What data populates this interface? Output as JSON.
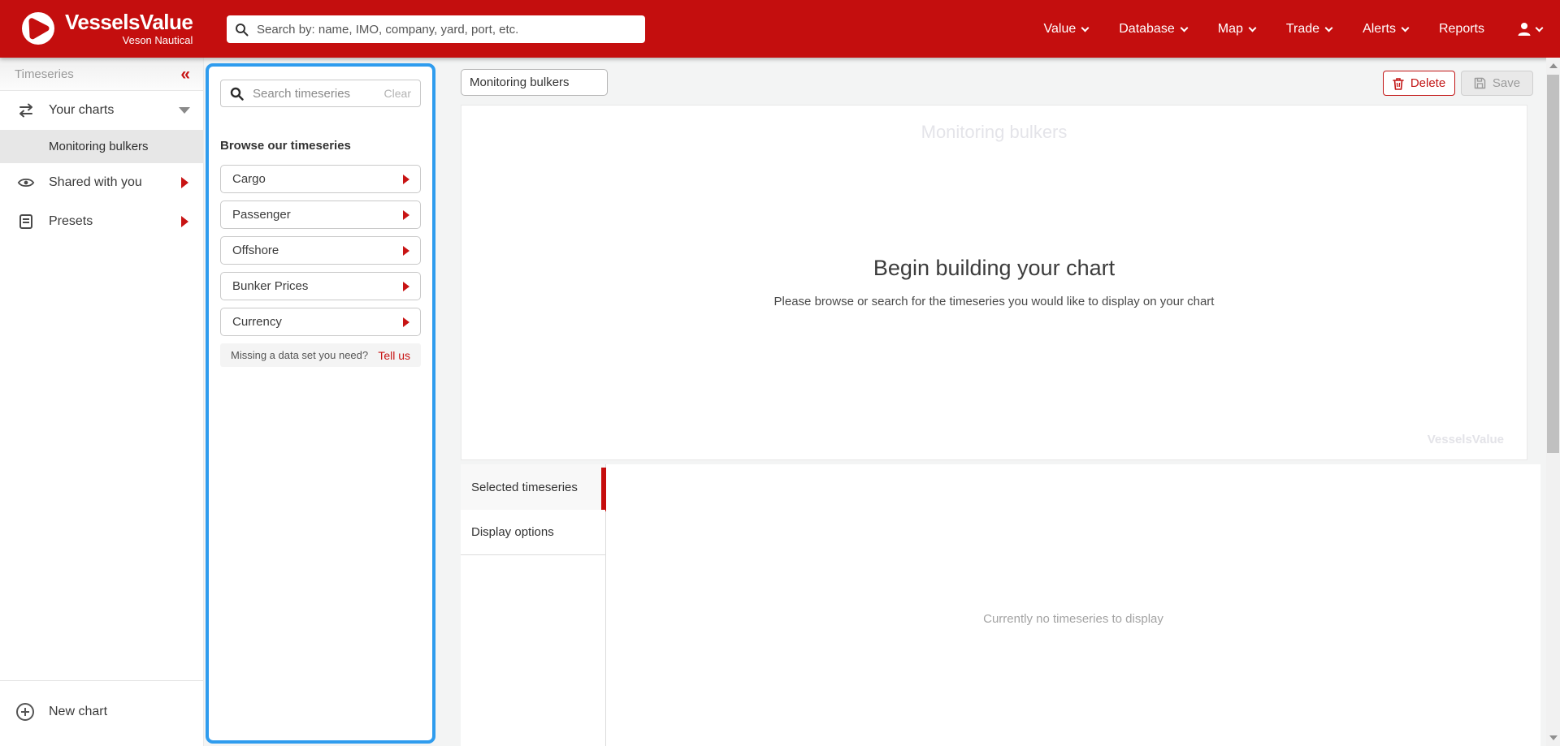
{
  "header": {
    "logo": {
      "title": "VesselsValue",
      "subtitle": "Veson Nautical"
    },
    "search": {
      "placeholder": "Search by: name, IMO, company, yard, port, etc."
    },
    "nav": [
      {
        "label": "Value",
        "caret": true
      },
      {
        "label": "Database",
        "caret": true
      },
      {
        "label": "Map",
        "caret": true
      },
      {
        "label": "Trade",
        "caret": true
      },
      {
        "label": "Alerts",
        "caret": true
      },
      {
        "label": "Reports",
        "caret": false
      }
    ]
  },
  "sidebar": {
    "section_label": "Timeseries",
    "collapse_glyph": "«",
    "your_charts_label": "Your charts",
    "chart_items": [
      {
        "label": "Monitoring bulkers",
        "selected": true
      }
    ],
    "shared_label": "Shared with you",
    "presets_label": "Presets",
    "new_chart_label": "New chart"
  },
  "browse_panel": {
    "search_placeholder": "Search timeseries",
    "clear_label": "Clear",
    "heading": "Browse our timeseries",
    "categories": [
      {
        "label": "Cargo"
      },
      {
        "label": "Passenger"
      },
      {
        "label": "Offshore"
      },
      {
        "label": "Bunker Prices"
      },
      {
        "label": "Currency"
      }
    ],
    "missing_text": "Missing a data set you need?",
    "missing_link": "Tell us"
  },
  "main": {
    "chart_title_value": "Monitoring bulkers",
    "delete_label": "Delete",
    "save_label": "Save",
    "chart_area": {
      "faint_title": "Monitoring bulkers",
      "empty_heading": "Begin building your chart",
      "empty_subtitle": "Please browse or search for the timeseries you would like to display on your chart",
      "watermark": "VesselsValue"
    },
    "tabs": [
      {
        "label": "Selected timeseries",
        "active": true
      },
      {
        "label": "Display options",
        "active": false
      }
    ],
    "empty_message": "Currently no timeseries to display"
  },
  "colors": {
    "brand_red": "#c40e0e",
    "accent_red": "#c81414",
    "highlight_blue": "#2f9cee"
  }
}
